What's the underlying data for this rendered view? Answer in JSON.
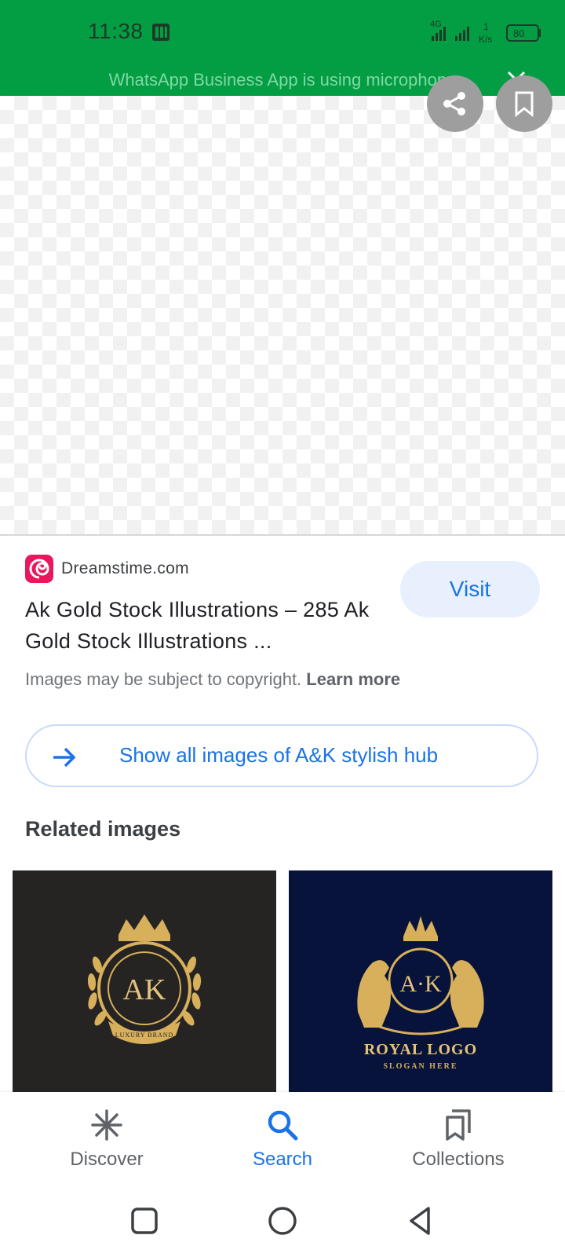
{
  "status_bar": {
    "time": "11:38",
    "network": "4G",
    "speed_value": "1",
    "speed_unit": "K/s",
    "battery": "80",
    "banner_text": "WhatsApp Business App is using microphone"
  },
  "result": {
    "source": "Dreamstime.com",
    "title": "Ak Gold Stock Illustrations – 285 Ak Gold Stock Illustrations ...",
    "visit_label": "Visit",
    "copyright_text": "Images may be subject to copyright.",
    "learn_more": "Learn more",
    "show_all_label": "Show all images of A&K stylish hub"
  },
  "related": {
    "heading": "Related images",
    "items": [
      {
        "monogram": "AK",
        "ribbon": "LUXURY BRAND",
        "background": "#262423"
      },
      {
        "monogram": "A·K",
        "line1": "ROYAL LOGO",
        "line2": "SLOGAN HERE",
        "background": "#07133a"
      }
    ]
  },
  "bottom_nav": {
    "items": [
      {
        "label": "Discover",
        "icon": "asterisk-icon"
      },
      {
        "label": "Search",
        "icon": "search-icon",
        "active": true
      },
      {
        "label": "Collections",
        "icon": "bookmarks-icon"
      }
    ]
  },
  "colors": {
    "status_bar": "#039d43",
    "accent": "#1a73e8",
    "gold": "#d8b05c"
  }
}
